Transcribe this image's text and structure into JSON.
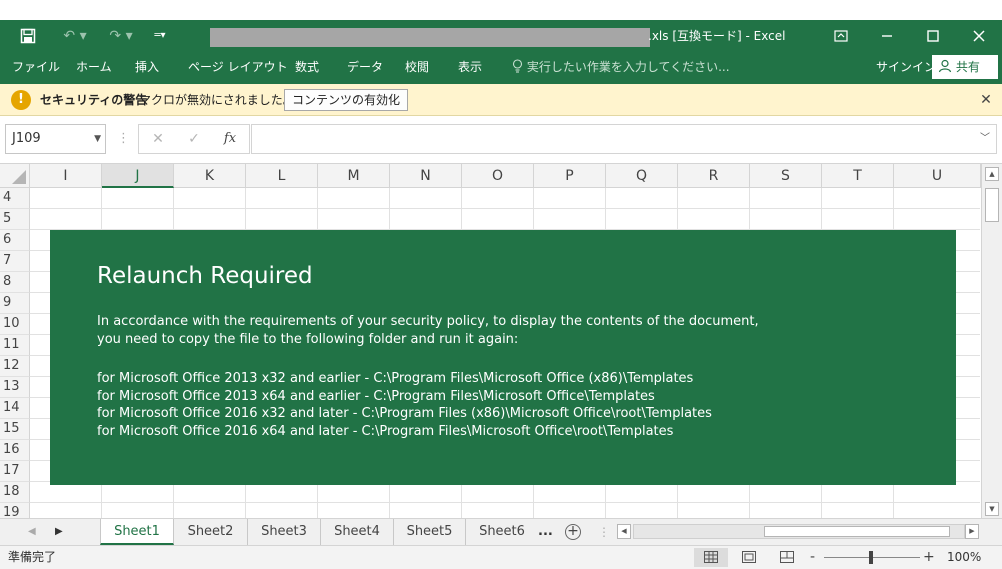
{
  "titlebar": {
    "save_icon": "save-icon",
    "undo_icon": "undo-icon",
    "redo_icon": "redo-icon",
    "customize_icon": "customize-qat-icon",
    "title": ".xls [互換モード] - Excel",
    "ribbon_display_icon": "ribbon-display-options-icon",
    "minimize_icon": "minimize-icon",
    "maximize_icon": "maximize-icon",
    "close_icon": "close-icon"
  },
  "ribbon": {
    "tabs": [
      "ファイル",
      "ホーム",
      "挿入",
      "ページ レイアウト",
      "数式",
      "データ",
      "校閲",
      "表示"
    ],
    "tell_me": "実行したい作業を入力してください...",
    "signin": "サインイン",
    "share": "共有"
  },
  "security_bar": {
    "title": "セキュリティの警告",
    "message": "マクロが無効にされました。",
    "button": "コンテンツの有効化"
  },
  "formula_bar": {
    "name_box": "J109",
    "cancel": "✕",
    "enter": "✓",
    "fx": "fx",
    "value": ""
  },
  "grid": {
    "columns": [
      "I",
      "J",
      "K",
      "L",
      "M",
      "N",
      "O",
      "P",
      "Q",
      "R",
      "S",
      "T",
      "U"
    ],
    "selected_column": "J",
    "rows": [
      "4",
      "5",
      "6",
      "7",
      "8",
      "9",
      "10",
      "11",
      "12",
      "13",
      "14",
      "15",
      "16",
      "17",
      "18",
      "19"
    ]
  },
  "dialog": {
    "title": "Relaunch Required",
    "paragraph1_line1": "In accordance with the requirements of your security policy, to display the contents of the document,",
    "paragraph1_line2": "you need to copy the file to the following folder and run it again:",
    "path_lines": [
      "for Microsoft Office 2013 x32 and earlier - C:\\Program Files\\Microsoft Office (x86)\\Templates",
      "for Microsoft Office 2013 x64 and earlier - C:\\Program Files\\Microsoft Office\\Templates",
      "for Microsoft Office 2016 x32 and later - C:\\Program Files (x86)\\Microsoft Office\\root\\Templates",
      "for Microsoft Office 2016 x64 and later - C:\\Program Files\\Microsoft Office\\root\\Templates"
    ],
    "background_color": "#217346"
  },
  "sheets": {
    "tabs": [
      "Sheet1",
      "Sheet2",
      "Sheet3",
      "Sheet4",
      "Sheet5",
      "Sheet6"
    ],
    "active": "Sheet1",
    "more": "...",
    "add": "+"
  },
  "status": {
    "ready": "準備完了",
    "zoom_minus": "-",
    "zoom_plus": "+",
    "zoom": "100%"
  },
  "colors": {
    "excel_green": "#217346",
    "security_bar_bg": "#fff4ce"
  }
}
